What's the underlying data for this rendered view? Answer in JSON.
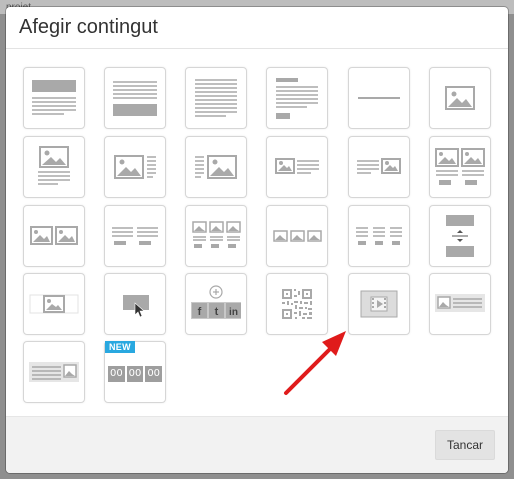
{
  "background": {
    "text": "projet"
  },
  "dialog": {
    "title": "Afegir contingut",
    "close_label": "Tancar"
  },
  "tiles": [
    {
      "name": "block-title-text"
    },
    {
      "name": "block-text-title"
    },
    {
      "name": "block-full-text"
    },
    {
      "name": "block-title-text-button"
    },
    {
      "name": "block-divider"
    },
    {
      "name": "block-image"
    },
    {
      "name": "block-image-text"
    },
    {
      "name": "block-image-text-right"
    },
    {
      "name": "block-text-image-right"
    },
    {
      "name": "block-image-small-text"
    },
    {
      "name": "block-text-image-small"
    },
    {
      "name": "block-two-images-text"
    },
    {
      "name": "block-two-images"
    },
    {
      "name": "block-two-text-columns"
    },
    {
      "name": "block-three-image-columns"
    },
    {
      "name": "block-three-images"
    },
    {
      "name": "block-three-text-columns"
    },
    {
      "name": "block-spacer"
    },
    {
      "name": "block-image-banner"
    },
    {
      "name": "block-click-image"
    },
    {
      "name": "block-social-share"
    },
    {
      "name": "block-qr-code"
    },
    {
      "name": "block-video"
    },
    {
      "name": "block-image-text-inline"
    },
    {
      "name": "block-text-image-inline"
    },
    {
      "name": "block-countdown"
    }
  ],
  "social": {
    "facebook": "f",
    "twitter": "t",
    "linkedin": "in"
  },
  "countdown": {
    "badge": "NEW",
    "hours": "00",
    "minutes": "00",
    "seconds": "00"
  },
  "colors": {
    "accent": "#29a8e0",
    "arrow": "#e01b1b",
    "icon_gray": "#a9a9a9"
  }
}
